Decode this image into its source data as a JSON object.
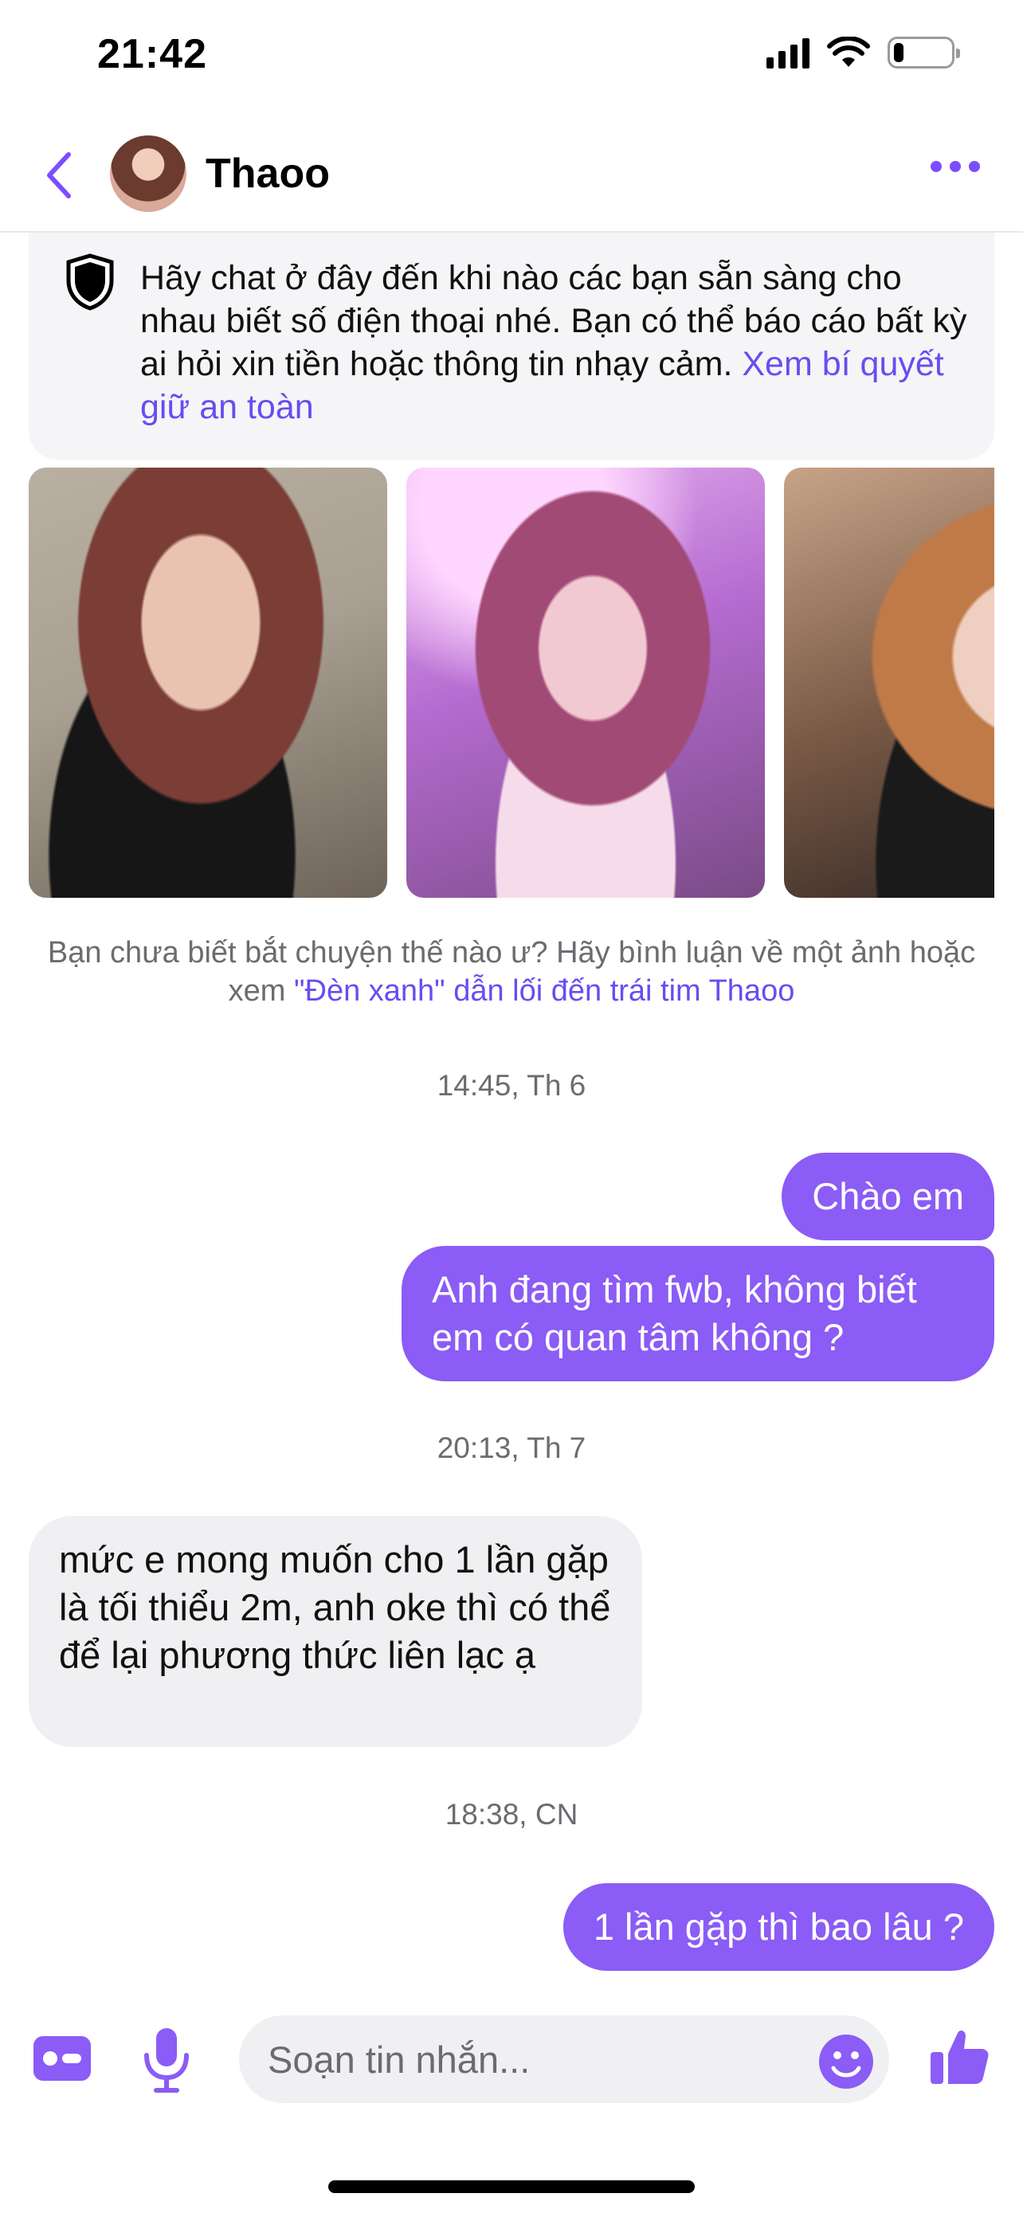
{
  "status_bar": {
    "time": "21:42",
    "battery_level": 0.18,
    "icons": [
      "signal-icon",
      "wifi-icon",
      "battery-icon"
    ]
  },
  "header": {
    "contact_name": "Thaoo",
    "icons": [
      "chevron-left-icon",
      "avatar",
      "more-icon"
    ],
    "accent_color": "#7c4dff"
  },
  "safety_notice": {
    "text": "Hãy chat ở đây đến khi nào các bạn sẵn sàng cho nhau biết số điện thoại nhé. Bạn có thể báo cáo bất kỳ ai hỏi xin tiền hoặc thông tin nhạy cảm.",
    "link": "Xem bí quyết giữ an toàn"
  },
  "hint": {
    "text": "Bạn chưa biết bắt chuyện thế nào ư? Hãy bình luận về một ảnh hoặc xem",
    "link": "\"Đèn xanh\" dẫn lối đến trái tim Thaoo"
  },
  "messages": [
    {
      "timestamp": "14:45, Th 6"
    },
    {
      "direction": "outgoing",
      "text": "Chào em"
    },
    {
      "direction": "outgoing",
      "text": "Anh đang tìm fwb, không biết em có quan tâm không ?"
    },
    {
      "timestamp": "20:13, Th 7"
    },
    {
      "direction": "incoming",
      "text": "mức e mong muốn cho 1 lần gặp là tối thiểu 2m, anh oke thì có thể để lại phương thức liên lạc ạ"
    },
    {
      "timestamp": "18:38, CN"
    },
    {
      "direction": "outgoing",
      "text": "1 lần gặp thì bao lâu ?"
    }
  ],
  "composer": {
    "placeholder": "Soạn tin nhắn...",
    "icons": [
      "profile-card-icon",
      "microphone-icon",
      "emoji-icon",
      "thumbs-up-icon"
    ]
  },
  "colors": {
    "outgoing_bubble": "#8b5cf6",
    "incoming_bubble": "#f0f0f2",
    "link": "#6a4cf0"
  }
}
